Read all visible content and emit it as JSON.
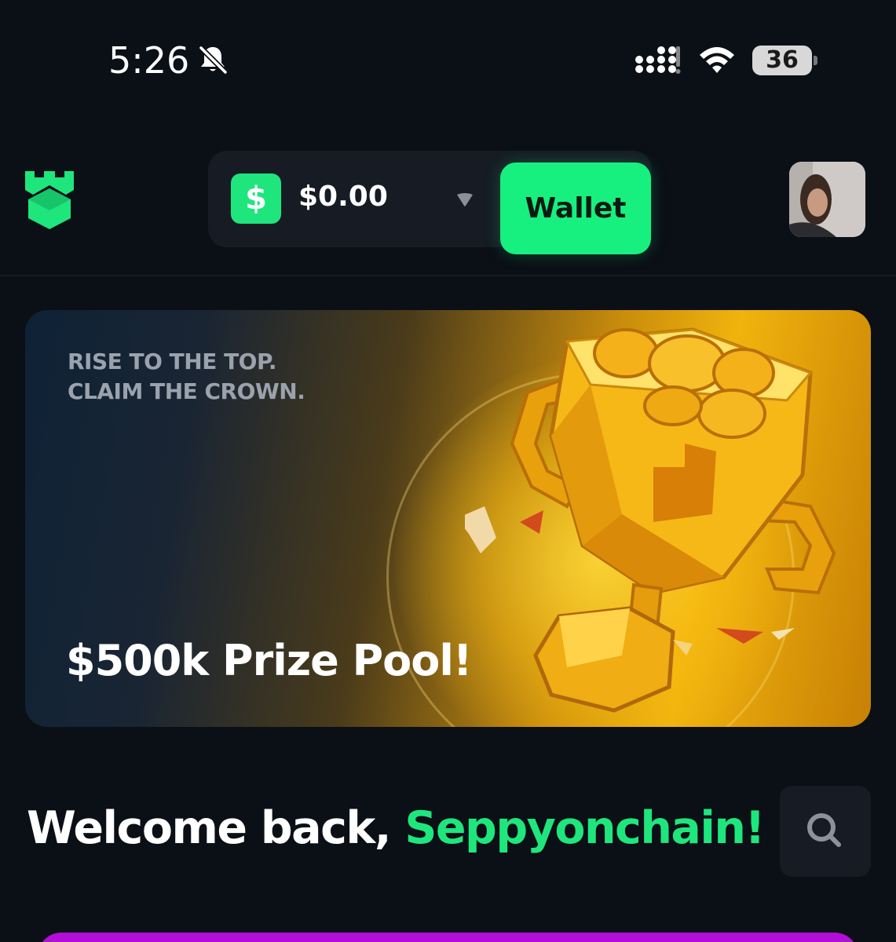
{
  "status_bar": {
    "time": "5:26",
    "battery": "36",
    "battery_level": 0.36,
    "icons": [
      "bell-slash-icon",
      "signal-icon",
      "wifi-icon",
      "battery-icon"
    ]
  },
  "header": {
    "logo": "castle-logo-icon",
    "currency_symbol": "$",
    "balance": "$0.00",
    "wallet_label": "Wallet",
    "accent_color": "#17f07e"
  },
  "banner": {
    "tagline_line1": "RISE TO THE TOP.",
    "tagline_line2": "CLAIM THE CROWN.",
    "prize": "$500k Prize Pool!"
  },
  "welcome": {
    "greeting": "Welcome back, ",
    "username": "Seppyonchain!"
  },
  "colors": {
    "background": "#0b0f16",
    "surface": "#161b24",
    "accent": "#1ee67d",
    "next_card": "#b10fd7"
  }
}
